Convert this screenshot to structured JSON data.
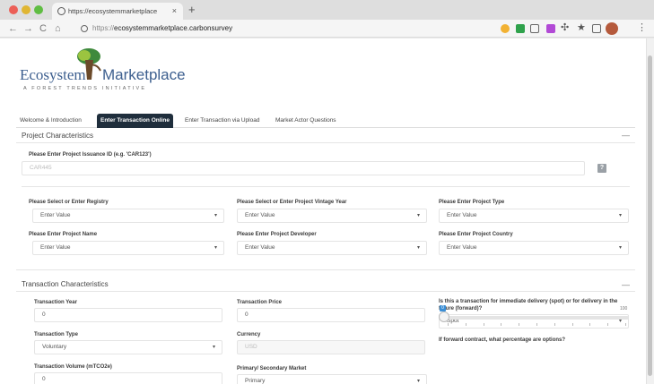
{
  "browser": {
    "tab_title": "https://ecosystemmarketplace",
    "tab_close": "×",
    "new_tab": "+",
    "url_host": "https://",
    "url_domain": "ecosystemmarketplace.carbonsurvey",
    "nav_back": "←",
    "nav_forward": "→",
    "nav_reload": "C",
    "nav_home": "⌂",
    "menu": "⋮",
    "ext_star": "★",
    "ext_puzzle": "✣"
  },
  "logo": {
    "word1": "Ecosystem",
    "word2": "Marketplace",
    "tagline": "A FOREST TRENDS INITIATIVE"
  },
  "tabs": [
    {
      "label": "Welcome & Introduction"
    },
    {
      "label": "Enter Transaction Online"
    },
    {
      "label": "Enter Transaction via Upload"
    },
    {
      "label": "Market Actor Questions"
    }
  ],
  "project": {
    "title": "Project Characteristics",
    "collapse": "—",
    "issuance_label": "Please Enter Project Issuance ID (e.g. 'CAR123')",
    "issuance_placeholder": "CAR445",
    "help": "?",
    "registry_label": "Please Select or Enter Registry",
    "vintage_label": "Please Select or Enter Project Vintage Year",
    "type_label": "Please Enter Project Type",
    "name_label": "Please Enter Project Name",
    "developer_label": "Please Enter Project Developer",
    "country_label": "Please Enter Project Country",
    "enter_value": "Enter Value",
    "caret": "▾"
  },
  "transaction": {
    "title": "Transaction Characteristics",
    "collapse": "—",
    "year_label": "Transaction Year",
    "year_value": "0",
    "price_label": "Transaction Price",
    "price_value": "0",
    "delivery_label": "Is this a transaction for immediate delivery (spot) or for delivery in the future (forward)?",
    "delivery_value": "Spot",
    "type_label": "Transaction Type",
    "type_value": "Voluntary",
    "currency_label": "Currency",
    "currency_value": "USD",
    "forward_label": "If forward contract, what percentage are options?",
    "slider_min": "0",
    "slider_max": "100",
    "slider_value_pct": 0,
    "volume_label": "Transaction Volume (mTCO2e)",
    "volume_value": "0",
    "market_label": "Primary/ Secondary Market",
    "market_value": "Primary",
    "caret": "▾"
  }
}
